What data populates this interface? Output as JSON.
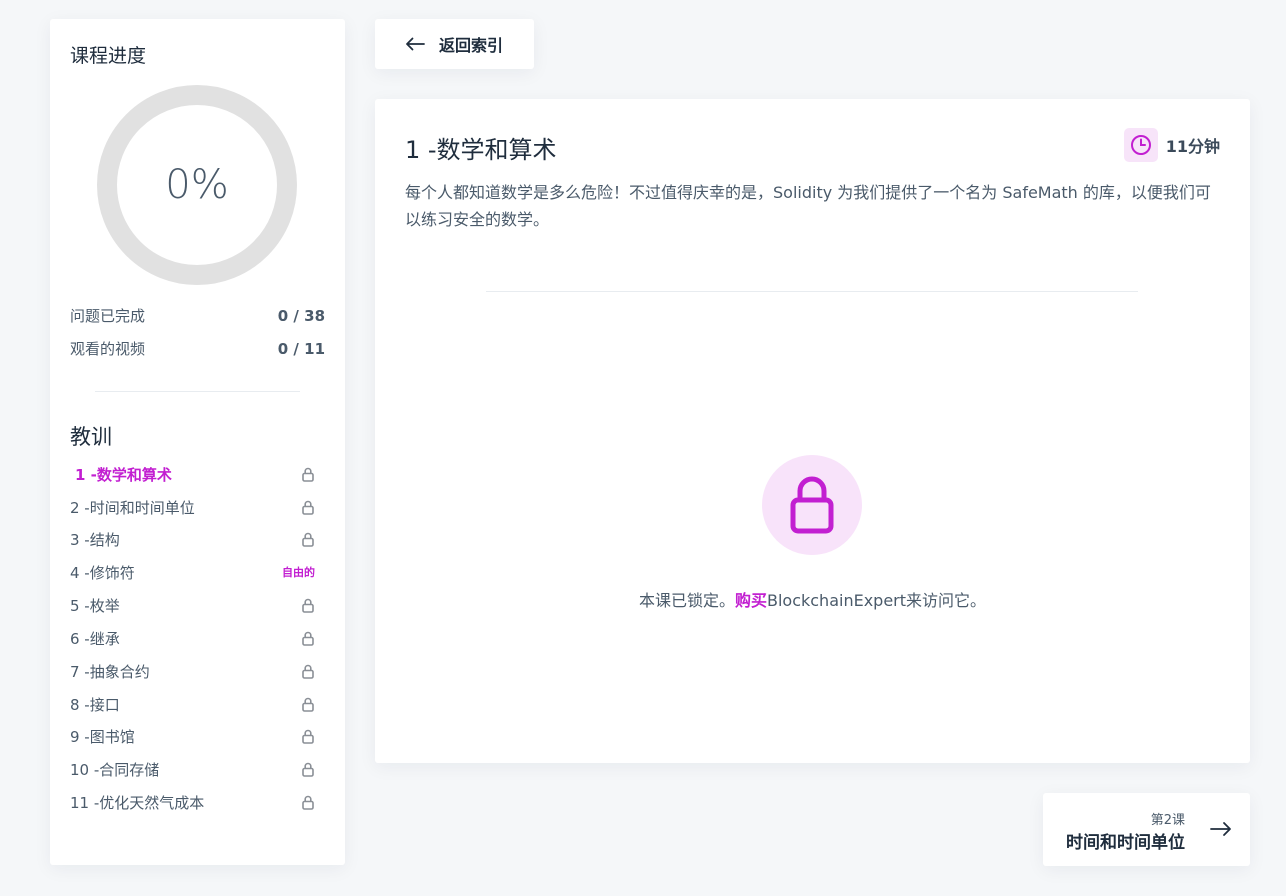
{
  "sidebar": {
    "title": "课程进度",
    "progress_percent": 0,
    "progress_label": "0%",
    "stats": [
      {
        "label": "问题已完成",
        "value": "0 / 38"
      },
      {
        "label": "观看的视频",
        "value": "0 / 11"
      }
    ],
    "lessons_title": "教训",
    "lessons": [
      {
        "label": "1 -数学和算术",
        "status": "locked",
        "active": true
      },
      {
        "label": "2 -时间和时间单位",
        "status": "locked"
      },
      {
        "label": "3 -结构",
        "status": "locked"
      },
      {
        "label": "4 -修饰符",
        "status": "free",
        "badge": "自由的"
      },
      {
        "label": "5 -枚举",
        "status": "locked"
      },
      {
        "label": "6 -继承",
        "status": "locked"
      },
      {
        "label": "7 -抽象合约",
        "status": "locked"
      },
      {
        "label": "8 -接口",
        "status": "locked"
      },
      {
        "label": "9 -图书馆",
        "status": "locked"
      },
      {
        "label": "10 -合同存储",
        "status": "locked"
      },
      {
        "label": "11 -优化天然气成本",
        "status": "locked"
      }
    ]
  },
  "back_button": {
    "label": "返回索引",
    "icon": "arrow-left-icon"
  },
  "main": {
    "title": "1 -数学和算术",
    "duration": "11分钟",
    "duration_icon": "clock-icon",
    "description": "每个人都知道数学是多么危险！不过值得庆幸的是，Solidity 为我们提供了一个名为 SafeMath 的库，以便我们可以练习安全的数学。",
    "locked": {
      "icon": "lock-icon",
      "text_before": "本课已锁定。",
      "buy_link": "购买",
      "text_after": "BlockchainExpert来访问它。"
    }
  },
  "next": {
    "subtitle": "第2课",
    "title": "时间和时间单位",
    "icon": "arrow-right-icon"
  },
  "colors": {
    "accent": "#c21fd1",
    "accent_light": "#f8e3fa",
    "ring": "#e1e1e1",
    "background": "#f5f7f9"
  }
}
